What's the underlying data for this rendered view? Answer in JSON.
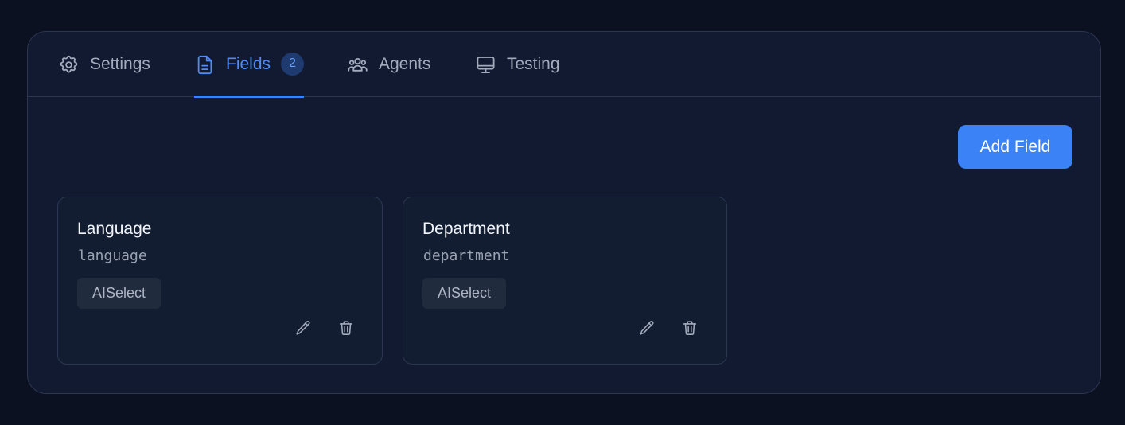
{
  "tabs": [
    {
      "label": "Settings",
      "icon": "gear-icon"
    },
    {
      "label": "Fields",
      "icon": "document-icon",
      "badge": "2",
      "active": true
    },
    {
      "label": "Agents",
      "icon": "users-icon"
    },
    {
      "label": "Testing",
      "icon": "monitor-icon"
    }
  ],
  "toolbar": {
    "add_label": "Add Field"
  },
  "fields": [
    {
      "title": "Language",
      "key": "language",
      "type": "AISelect"
    },
    {
      "title": "Department",
      "key": "department",
      "type": "AISelect"
    }
  ],
  "colors": {
    "background": "#0b1120",
    "panel": "#111a31",
    "accent": "#3b82f6",
    "text_muted": "#a3acbd"
  }
}
